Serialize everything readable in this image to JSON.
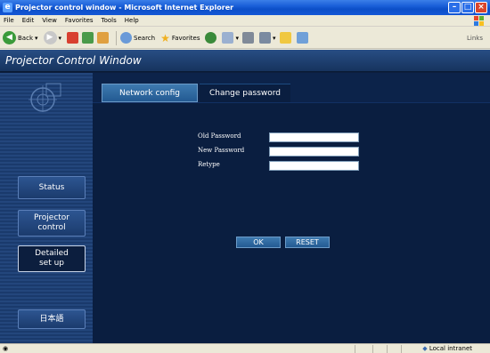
{
  "window": {
    "title": "Projector control window - Microsoft Internet Explorer",
    "controls": [
      "minimize-icon",
      "maximize-icon",
      "close-icon"
    ]
  },
  "menu": [
    "File",
    "Edit",
    "View",
    "Favorites",
    "Tools",
    "Help"
  ],
  "toolbar": {
    "back_label": "Back",
    "search_label": "Search",
    "favorites_label": "Favorites",
    "links_label": "Links"
  },
  "app": {
    "header_title": "Projector Control Window"
  },
  "sidebar": {
    "items": [
      {
        "label": "Status"
      },
      {
        "label_line1": "Projector",
        "label_line2": "control"
      },
      {
        "label_line1": "Detailed",
        "label_line2": "set up"
      },
      {
        "label": "日本語"
      }
    ]
  },
  "tabs": {
    "network": "Network config",
    "password": "Change password"
  },
  "form": {
    "old_password_label": "Old Password",
    "new_password_label": "New Password",
    "retype_label": "Retype",
    "old_password_value": "",
    "new_password_value": "",
    "retype_value": "",
    "ok_label": "OK",
    "reset_label": "RESET"
  },
  "statusbar": {
    "zone": "Local intranet"
  },
  "colors": {
    "page_bg": "#0c1e3e",
    "tab_active": "#0a1e40",
    "tab_inactive": "#2d69a3"
  }
}
